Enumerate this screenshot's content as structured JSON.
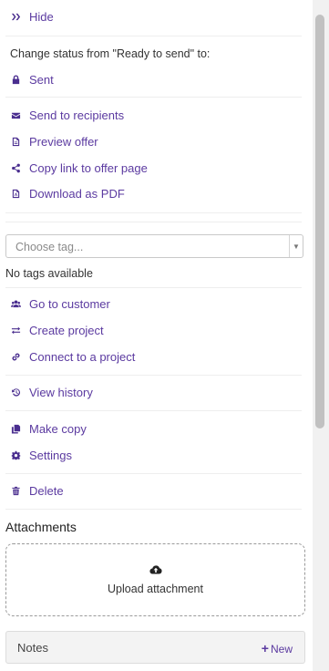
{
  "hide_label": "Hide",
  "status": {
    "text": "Change status from \"Ready to send\" to:",
    "options": [
      {
        "label": "Sent",
        "icon": "lock-icon"
      }
    ]
  },
  "actions_send": [
    {
      "label": "Send to recipients",
      "icon": "envelope-icon"
    },
    {
      "label": "Preview offer",
      "icon": "document-icon"
    },
    {
      "label": "Copy link to offer page",
      "icon": "share-icon"
    },
    {
      "label": "Download as PDF",
      "icon": "pdf-icon"
    }
  ],
  "tags": {
    "placeholder": "Choose tag...",
    "empty_text": "No tags available"
  },
  "actions_links": [
    {
      "label": "Go to customer",
      "icon": "users-icon"
    },
    {
      "label": "Create project",
      "icon": "exchange-icon"
    },
    {
      "label": "Connect to a project",
      "icon": "link-icon"
    }
  ],
  "history_label": "View history",
  "actions_misc": [
    {
      "label": "Make copy",
      "icon": "copy-icon"
    },
    {
      "label": "Settings",
      "icon": "gear-icon"
    }
  ],
  "delete_label": "Delete",
  "attachments": {
    "heading": "Attachments",
    "upload_label": "Upload attachment"
  },
  "notes": {
    "label": "Notes",
    "new_label": "New"
  },
  "colors": {
    "accent": "#5b3aa0",
    "icon": "#4a2e8f"
  }
}
